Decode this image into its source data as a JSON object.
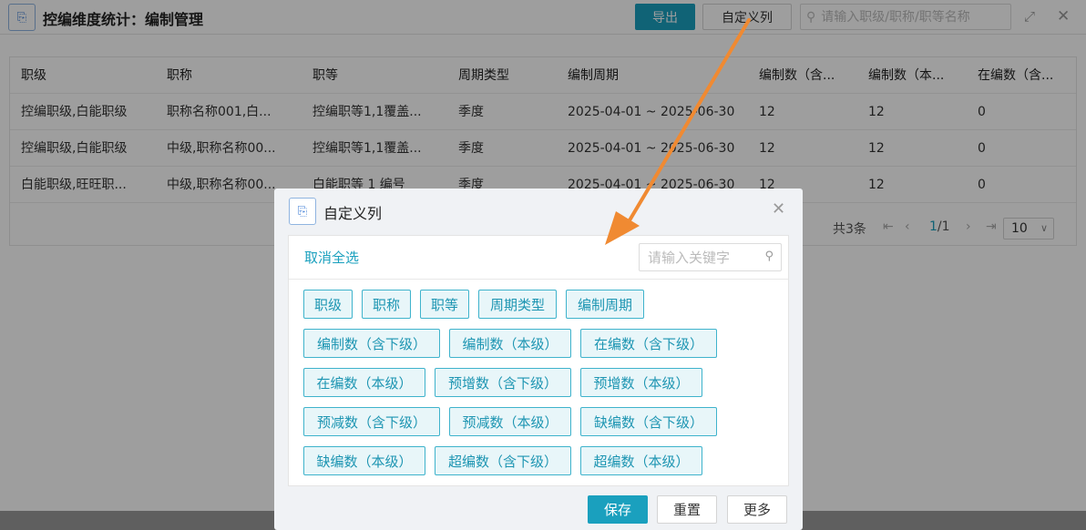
{
  "header": {
    "title": "控编维度统计：编制管理",
    "export_label": "导出",
    "custom_columns_label": "自定义列",
    "search_placeholder": "请输入职级/职称/职等名称"
  },
  "table": {
    "columns": [
      "职级",
      "职称",
      "职等",
      "周期类型",
      "编制周期",
      "编制数（含...",
      "编制数（本...",
      "在编数（含..."
    ],
    "rows": [
      [
        "控编职级,白能职级",
        "职称名称001,白...",
        "控编职等1,1覆盖...",
        "季度",
        "2025-04-01 ~ 2025-06-30",
        "12",
        "12",
        "0"
      ],
      [
        "控编职级,白能职级",
        "中级,职称名称00...",
        "控编职等1,1覆盖...",
        "季度",
        "2025-04-01 ~ 2025-06-30",
        "12",
        "12",
        "0"
      ],
      [
        "白能职级,旺旺职...",
        "中级,职称名称00...",
        "白能职等 1 编号",
        "季度",
        "2025-04-01 ~ 2025-06-30",
        "12",
        "12",
        "0"
      ]
    ],
    "pagination": {
      "total_text": "共3条",
      "current_page": "1",
      "total_pages": "/1",
      "page_size": "10"
    }
  },
  "modal": {
    "title": "自定义列",
    "deselect_all_label": "取消全选",
    "keyword_placeholder": "请输入关键字",
    "columns": [
      "职级",
      "职称",
      "职等",
      "周期类型",
      "编制周期",
      "编制数（含下级）",
      "编制数（本级）",
      "在编数（含下级）",
      "在编数（本级）",
      "预增数（含下级）",
      "预增数（本级）",
      "预减数（含下级）",
      "预减数（本级）",
      "缺编数（含下级）",
      "缺编数（本级）",
      "超编数（含下级）",
      "超编数（本级）"
    ],
    "save_label": "保存",
    "reset_label": "重置",
    "more_label": "更多"
  },
  "colors": {
    "accent": "#1aa0be",
    "chip_border": "#3fb3cc",
    "chip_bg": "#e8f6f9",
    "annotation_arrow": "#f08a32"
  },
  "icons": {
    "header_icon": "document-icon",
    "search": "search-icon",
    "expand": "expand-icon",
    "close": "close-icon"
  }
}
